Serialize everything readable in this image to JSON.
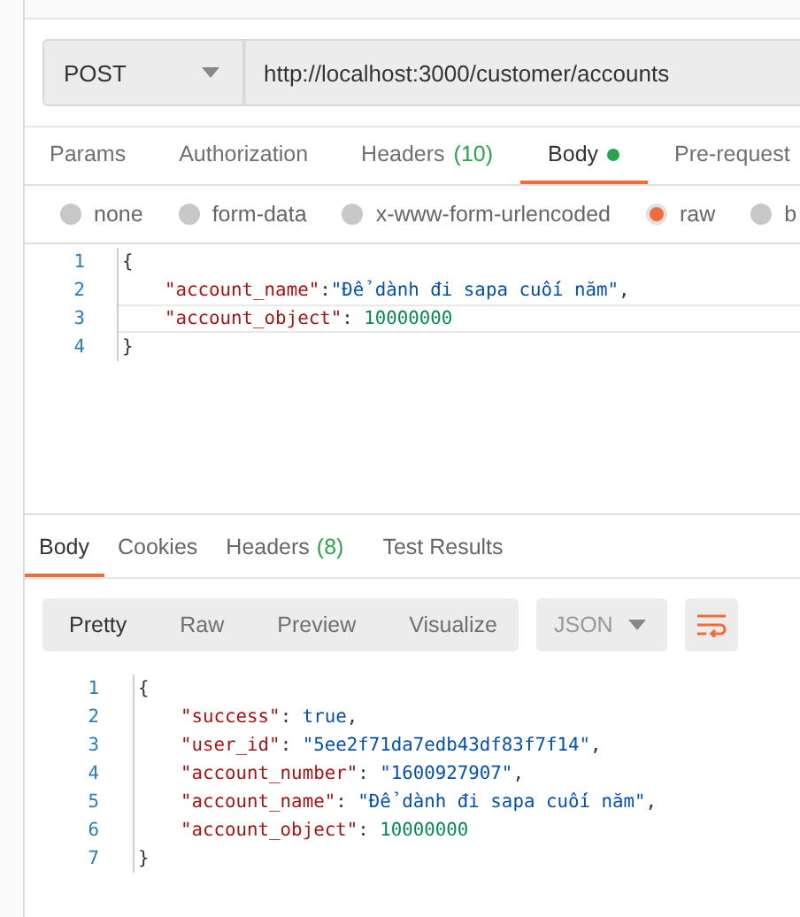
{
  "request": {
    "method": "POST",
    "url": "http://localhost:3000/customer/accounts"
  },
  "request_tabs": [
    {
      "label": "Params",
      "selected": false
    },
    {
      "label": "Authorization",
      "selected": false
    },
    {
      "label": "Headers",
      "count": "(10)",
      "selected": false
    },
    {
      "label": "Body",
      "has_content": true,
      "selected": true
    },
    {
      "label": "Pre-request",
      "selected": false
    }
  ],
  "body_types": [
    {
      "label": "none",
      "selected": false
    },
    {
      "label": "form-data",
      "selected": false
    },
    {
      "label": "x-www-form-urlencoded",
      "selected": false
    },
    {
      "label": "raw",
      "selected": true
    },
    {
      "label": "b",
      "selected": false
    }
  ],
  "request_editor": {
    "lines": [
      {
        "number": "1",
        "kind": "open",
        "active": false,
        "tokens": [
          {
            "kind": "punct",
            "text": "{"
          }
        ]
      },
      {
        "number": "2",
        "kind": "entry",
        "active": false,
        "tokens": [
          {
            "kind": "key",
            "text": "\"account_name\""
          },
          {
            "kind": "punct",
            "text": ":"
          },
          {
            "kind": "string",
            "text": "\"Để dành đi sapa cuối năm\""
          },
          {
            "kind": "punct",
            "text": ","
          }
        ]
      },
      {
        "number": "3",
        "kind": "entry",
        "active": true,
        "tokens": [
          {
            "kind": "key",
            "text": "\"account_object\""
          },
          {
            "kind": "punct",
            "text": ": "
          },
          {
            "kind": "number",
            "text": "10000000"
          }
        ]
      },
      {
        "number": "4",
        "kind": "close",
        "active": false,
        "tokens": [
          {
            "kind": "punct",
            "text": "}"
          }
        ]
      }
    ]
  },
  "response_tabs": [
    {
      "label": "Body",
      "selected": true
    },
    {
      "label": "Cookies",
      "selected": false
    },
    {
      "label": "Headers",
      "count": "(8)",
      "selected": false
    },
    {
      "label": "Test Results",
      "selected": false
    }
  ],
  "view_modes": [
    {
      "label": "Pretty",
      "selected": true
    },
    {
      "label": "Raw",
      "selected": false
    },
    {
      "label": "Preview",
      "selected": false
    },
    {
      "label": "Visualize",
      "selected": false
    }
  ],
  "format": "JSON",
  "response_body": {
    "lines": [
      {
        "number": "1",
        "kind": "open",
        "active": false,
        "tokens": [
          {
            "kind": "punct",
            "text": "{"
          }
        ]
      },
      {
        "number": "2",
        "kind": "entry",
        "active": false,
        "tokens": [
          {
            "kind": "key",
            "text": "\"success\""
          },
          {
            "kind": "punct",
            "text": ": "
          },
          {
            "kind": "bool",
            "text": "true"
          },
          {
            "kind": "punct",
            "text": ","
          }
        ]
      },
      {
        "number": "3",
        "kind": "entry",
        "active": false,
        "tokens": [
          {
            "kind": "key",
            "text": "\"user_id\""
          },
          {
            "kind": "punct",
            "text": ": "
          },
          {
            "kind": "string",
            "text": "\"5ee2f71da7edb43df83f7f14\""
          },
          {
            "kind": "punct",
            "text": ","
          }
        ]
      },
      {
        "number": "4",
        "kind": "entry",
        "active": false,
        "tokens": [
          {
            "kind": "key",
            "text": "\"account_number\""
          },
          {
            "kind": "punct",
            "text": ": "
          },
          {
            "kind": "string",
            "text": "\"1600927907\""
          },
          {
            "kind": "punct",
            "text": ","
          }
        ]
      },
      {
        "number": "5",
        "kind": "entry",
        "active": false,
        "tokens": [
          {
            "kind": "key",
            "text": "\"account_name\""
          },
          {
            "kind": "punct",
            "text": ": "
          },
          {
            "kind": "string",
            "text": "\"Để dành đi sapa cuối năm\""
          },
          {
            "kind": "punct",
            "text": ","
          }
        ]
      },
      {
        "number": "6",
        "kind": "entry",
        "active": false,
        "tokens": [
          {
            "kind": "key",
            "text": "\"account_object\""
          },
          {
            "kind": "punct",
            "text": ": "
          },
          {
            "kind": "number",
            "text": "10000000"
          }
        ]
      },
      {
        "number": "7",
        "kind": "close",
        "active": false,
        "tokens": [
          {
            "kind": "punct",
            "text": "}"
          }
        ]
      }
    ]
  }
}
